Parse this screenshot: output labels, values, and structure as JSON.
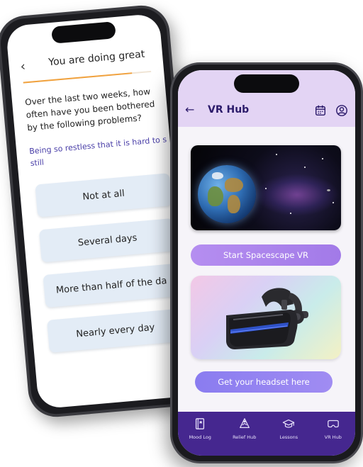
{
  "survey": {
    "back_icon": "chevron-left-icon",
    "title": "You are doing great",
    "progress": 0.85,
    "progress_color": "#f1a23e",
    "question": "Over the last two weeks, how often have you been bothered by the following problems?",
    "item": "Being so restless that it is hard to s",
    "item_tail": "still",
    "options": [
      "Not at all",
      "Several days",
      "More than half of the da",
      "Nearly every day"
    ]
  },
  "vr_hub": {
    "title": "VR Hub",
    "header_icons": [
      "back-arrow-icon",
      "calendar-icon",
      "account-icon"
    ],
    "start_button": "Start Spacescape VR",
    "headset_button": "Get your headset here",
    "colors": {
      "header_bg": "#e3d4f4",
      "accent": "#a27ae8",
      "nav_bg": "#45278f"
    }
  },
  "nav": {
    "items": [
      {
        "label": "Mood Log",
        "icon": "book-icon"
      },
      {
        "label": "Relief Hub",
        "icon": "relief-icon"
      },
      {
        "label": "Lessons",
        "icon": "graduation-cap-icon"
      },
      {
        "label": "VR Hub",
        "icon": "vr-headset-icon"
      }
    ]
  }
}
